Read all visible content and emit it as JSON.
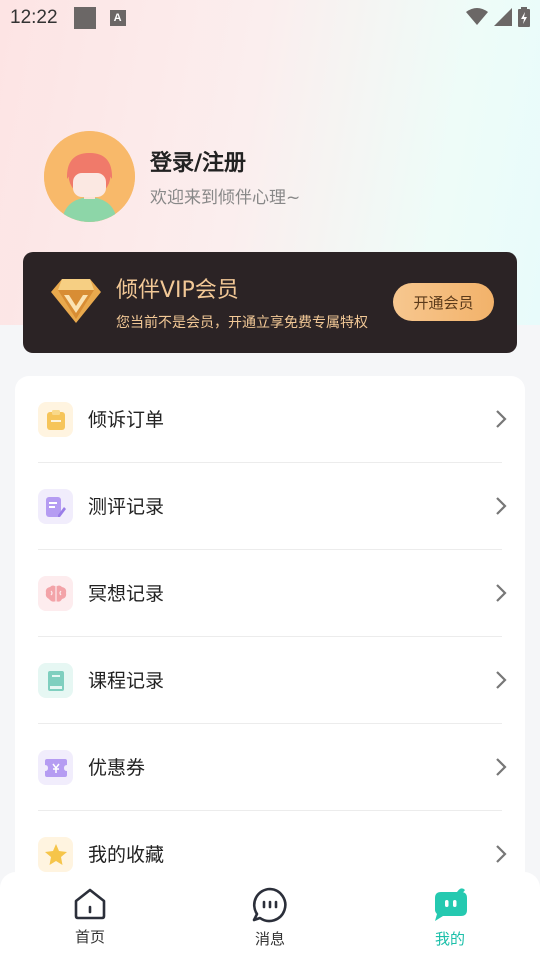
{
  "status_bar": {
    "time": "12:22",
    "a_badge": "A"
  },
  "profile": {
    "title": "登录/注册",
    "subtitle": "欢迎来到倾伴心理~"
  },
  "vip": {
    "title": "倾伴VIP会员",
    "description": "您当前不是会员，开通立享免费专属特权",
    "button_label": "开通会员"
  },
  "menu": [
    {
      "label": "倾诉订单",
      "icon": "document-icon",
      "icon_bg": "#fff4e0",
      "icon_color": "#f6c55a"
    },
    {
      "label": "测评记录",
      "icon": "edit-document-icon",
      "icon_bg": "#f1edfc",
      "icon_color": "#b59cf2"
    },
    {
      "label": "冥想记录",
      "icon": "brain-icon",
      "icon_bg": "#fdecee",
      "icon_color": "#f3a3a8"
    },
    {
      "label": "课程记录",
      "icon": "book-icon",
      "icon_bg": "#e6f7f3",
      "icon_color": "#7fcfbf"
    },
    {
      "label": "优惠券",
      "icon": "ticket-icon",
      "icon_bg": "#f1edfc",
      "icon_color": "#b59cf2"
    },
    {
      "label": "我的收藏",
      "icon": "star-icon",
      "icon_bg": "#fff4e0",
      "icon_color": "#f6c54a"
    }
  ],
  "tabs": [
    {
      "label": "首页",
      "icon": "home-icon",
      "active": false
    },
    {
      "label": "消息",
      "icon": "chat-icon",
      "active": false
    },
    {
      "label": "我的",
      "icon": "profile-chat-icon",
      "active": true
    }
  ],
  "colors": {
    "vip_bg": "#2b2325",
    "vip_gold": "#f2c896",
    "active_tab": "#1bbfa9"
  }
}
